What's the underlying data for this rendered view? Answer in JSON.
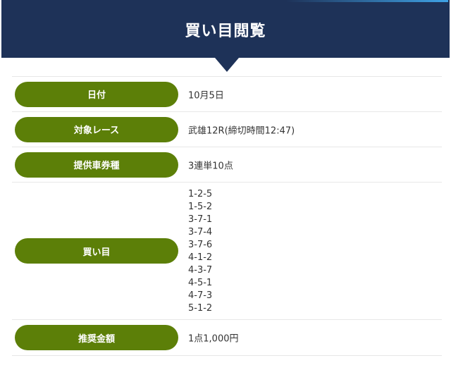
{
  "header": {
    "title": "買い目閲覧"
  },
  "rows": [
    {
      "label": "日付",
      "value": "10月5日"
    },
    {
      "label": "対象レース",
      "value": "武雄12R(締切時間12:47)"
    },
    {
      "label": "提供車券種",
      "value": "3連単10点"
    },
    {
      "label": "買い目",
      "values": [
        "1-2-5",
        "1-5-2",
        "3-7-1",
        "3-7-4",
        "3-7-6",
        "4-1-2",
        "4-3-7",
        "4-5-1",
        "4-7-3",
        "5-1-2"
      ]
    },
    {
      "label": "推奨金額",
      "value": "1点1,000円"
    }
  ],
  "colors": {
    "header_bg": "#1e3258",
    "pill_bg": "#5c7f08"
  }
}
